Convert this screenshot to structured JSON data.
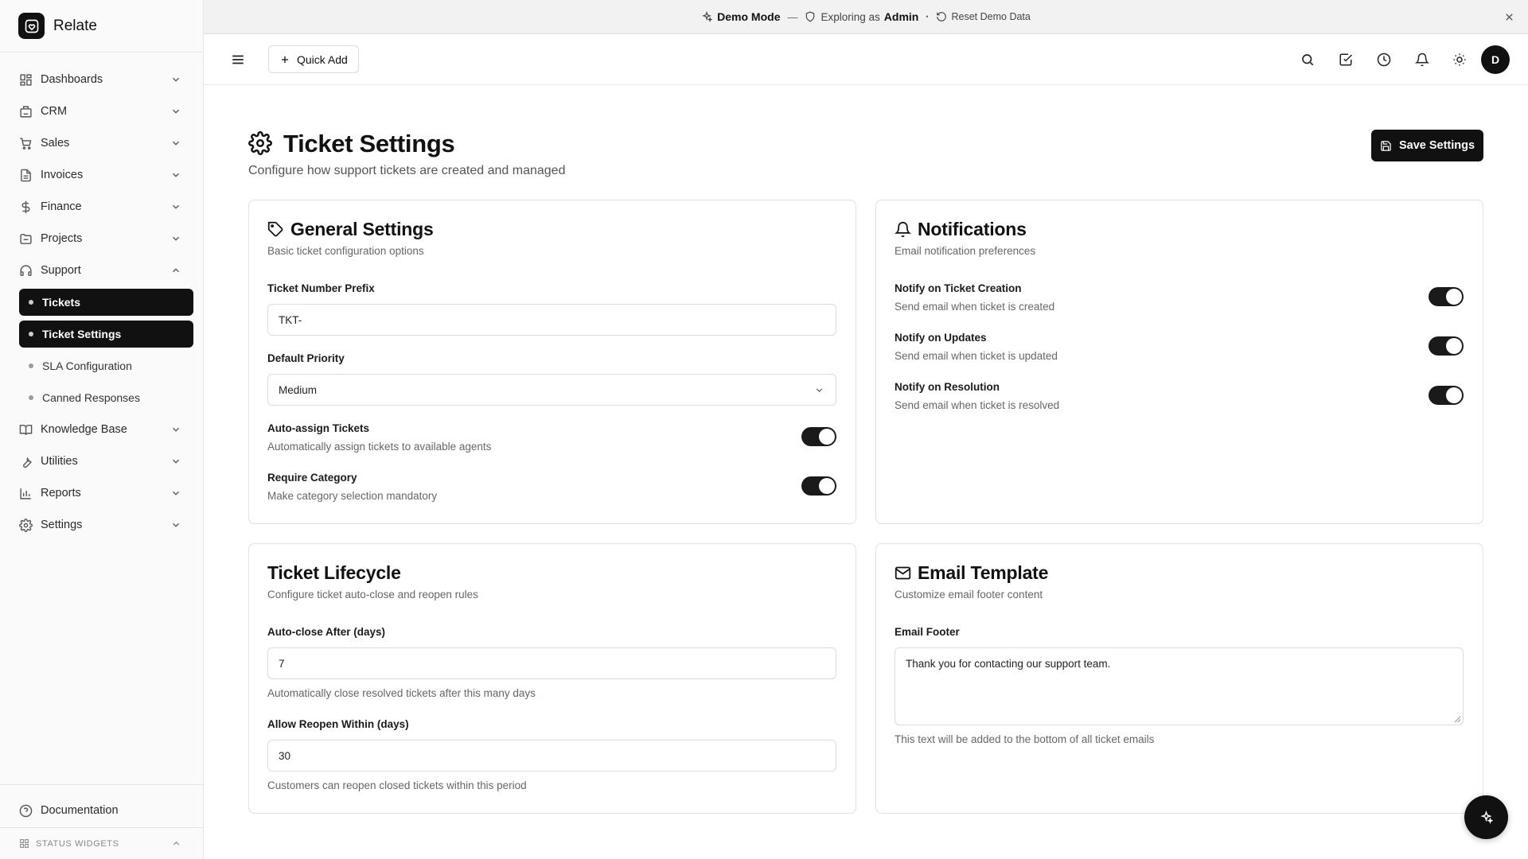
{
  "app": {
    "name": "Relate"
  },
  "demo_banner": {
    "mode": "Demo Mode",
    "dash": "—",
    "exploring_prefix": "Exploring as",
    "role": "Admin",
    "bullet": "•",
    "reset": "Reset Demo Data"
  },
  "topbar": {
    "quick_add": "Quick Add",
    "avatar_initial": "D"
  },
  "sidebar": {
    "items": [
      {
        "label": "Dashboards",
        "icon": "dashboard-icon"
      },
      {
        "label": "CRM",
        "icon": "building-icon"
      },
      {
        "label": "Sales",
        "icon": "cart-icon"
      },
      {
        "label": "Invoices",
        "icon": "invoice-icon"
      },
      {
        "label": "Finance",
        "icon": "dollar-icon"
      },
      {
        "label": "Projects",
        "icon": "folder-icon"
      },
      {
        "label": "Support",
        "icon": "headset-icon"
      },
      {
        "label": "Knowledge Base",
        "icon": "book-icon"
      },
      {
        "label": "Utilities",
        "icon": "wrench-icon"
      },
      {
        "label": "Reports",
        "icon": "bar-chart-icon"
      },
      {
        "label": "Settings",
        "icon": "gear-icon"
      }
    ],
    "support_sub": [
      {
        "label": "Tickets",
        "active": true
      },
      {
        "label": "Ticket Settings",
        "active": true
      },
      {
        "label": "SLA Configuration",
        "active": false
      },
      {
        "label": "Canned Responses",
        "active": false
      }
    ],
    "documentation": "Documentation",
    "status_widgets": "STATUS WIDGETS"
  },
  "page": {
    "title": "Ticket Settings",
    "subtitle": "Configure how support tickets are created and managed",
    "save_button": "Save Settings"
  },
  "general": {
    "title": "General Settings",
    "desc": "Basic ticket configuration options",
    "prefix_label": "Ticket Number Prefix",
    "prefix_value": "TKT-",
    "priority_label": "Default Priority",
    "priority_value": "Medium",
    "auto_assign_title": "Auto-assign Tickets",
    "auto_assign_desc": "Automatically assign tickets to available agents",
    "auto_assign_on": true,
    "require_cat_title": "Require Category",
    "require_cat_desc": "Make category selection mandatory",
    "require_cat_on": true
  },
  "notifications": {
    "title": "Notifications",
    "desc": "Email notification preferences",
    "items": [
      {
        "title": "Notify on Ticket Creation",
        "desc": "Send email when ticket is created",
        "on": true
      },
      {
        "title": "Notify on Updates",
        "desc": "Send email when ticket is updated",
        "on": true
      },
      {
        "title": "Notify on Resolution",
        "desc": "Send email when ticket is resolved",
        "on": true
      }
    ]
  },
  "lifecycle": {
    "title": "Ticket Lifecycle",
    "desc": "Configure ticket auto-close and reopen rules",
    "autoclose_label": "Auto-close After (days)",
    "autoclose_value": "7",
    "autoclose_hint": "Automatically close resolved tickets after this many days",
    "reopen_label": "Allow Reopen Within (days)",
    "reopen_value": "30",
    "reopen_hint": "Customers can reopen closed tickets within this period"
  },
  "email_template": {
    "title": "Email Template",
    "desc": "Customize email footer content",
    "footer_label": "Email Footer",
    "footer_value": "Thank you for contacting our support team.",
    "footer_hint": "This text will be added to the bottom of all ticket emails"
  }
}
